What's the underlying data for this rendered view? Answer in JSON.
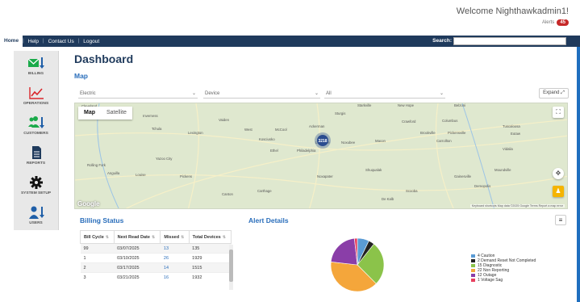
{
  "header": {
    "welcome": "Welcome Nighthawkadmin1!",
    "alerts_label": "Alerts",
    "alerts_count": "45"
  },
  "nav": {
    "items": [
      "Home",
      "Help",
      "Contact Us",
      "Logout"
    ],
    "search_label": "Search:"
  },
  "sidebar": {
    "items": [
      {
        "label": "BILLING",
        "icon": "billing-icon",
        "color": "#1aaa4a"
      },
      {
        "label": "OPERATIONS",
        "icon": "trend-chart-icon",
        "color": "#d9252a"
      },
      {
        "label": "CUSTOMERS",
        "icon": "customers-icon",
        "color": "#1aaa4a"
      },
      {
        "label": "REPORTS",
        "icon": "document-icon",
        "color": "#1f3a5c"
      },
      {
        "label": "SYSTEM SETUP",
        "icon": "gear-icon",
        "color": "#111111"
      },
      {
        "label": "USERS",
        "icon": "users-icon",
        "color": "#1f5fa8"
      }
    ]
  },
  "main": {
    "title": "Dashboard",
    "map_heading": "Map",
    "filters": [
      "Electric",
      "Device",
      "All"
    ],
    "expand_label": "Expand",
    "map": {
      "tabs": [
        "Map",
        "Satellite"
      ],
      "cluster_count": "3218",
      "attribution": "Keyboard shortcuts  Map data ©2025 Google  Terms  Report a map error",
      "logo": "Google",
      "places": [
        "Cleveland",
        "Indianola",
        "Inverness",
        "Vaiden",
        "Sturgis",
        "Starkville",
        "New Hope",
        "Crawford",
        "Columbus",
        "Belzoni",
        "Tchula",
        "Lexington",
        "West",
        "McCool",
        "Ackerman",
        "Louisville",
        "Noxubee",
        "Macon",
        "Carrollton",
        "Brookville",
        "Pickensville",
        "Eutaw",
        "Yazoo City",
        "Kosciusko",
        "Ethel",
        "Philadelphia",
        "Vidalia",
        "Gainesville",
        "Demopolis",
        "Rolling Fork",
        "Pickens",
        "Canton",
        "Carthage",
        "Noxapater",
        "Shuqualak",
        "De Kalb",
        "Scooba",
        "Anguilla",
        "Louise",
        "Tuscaloosa",
        "Moundville"
      ]
    },
    "billing": {
      "title": "Billing Status",
      "columns": [
        "Bill Cycle",
        "Next Read Date",
        "Missed",
        "Total Devices"
      ],
      "rows": [
        [
          "99",
          "03/07/2025",
          "13",
          "135"
        ],
        [
          "1",
          "03/10/2025",
          "26",
          "1929"
        ],
        [
          "2",
          "03/17/2025",
          "14",
          "1515"
        ],
        [
          "3",
          "03/21/2025",
          "16",
          "1932"
        ]
      ]
    },
    "alerts": {
      "title": "Alert Details",
      "menu_icon": "hamburger-icon"
    }
  },
  "chart_data": {
    "type": "pie",
    "categories": [
      "Caution",
      "Demand Reset Not Completed",
      "Diagnostic",
      "Non Reporting",
      "Outage",
      "Voltage Sag"
    ],
    "values": [
      4,
      2,
      15,
      22,
      12,
      1
    ],
    "labels": [
      "4 Caution",
      "2 Demand Reset Not Completed",
      "15 Diagnostic",
      "22 Non Reporting",
      "12 Outage",
      "1 Voltage Sag"
    ],
    "colors": [
      "#5a9bd5",
      "#222222",
      "#8bc34a",
      "#f4a63b",
      "#8a3ea8",
      "#e8405f"
    ],
    "legend": "right"
  }
}
